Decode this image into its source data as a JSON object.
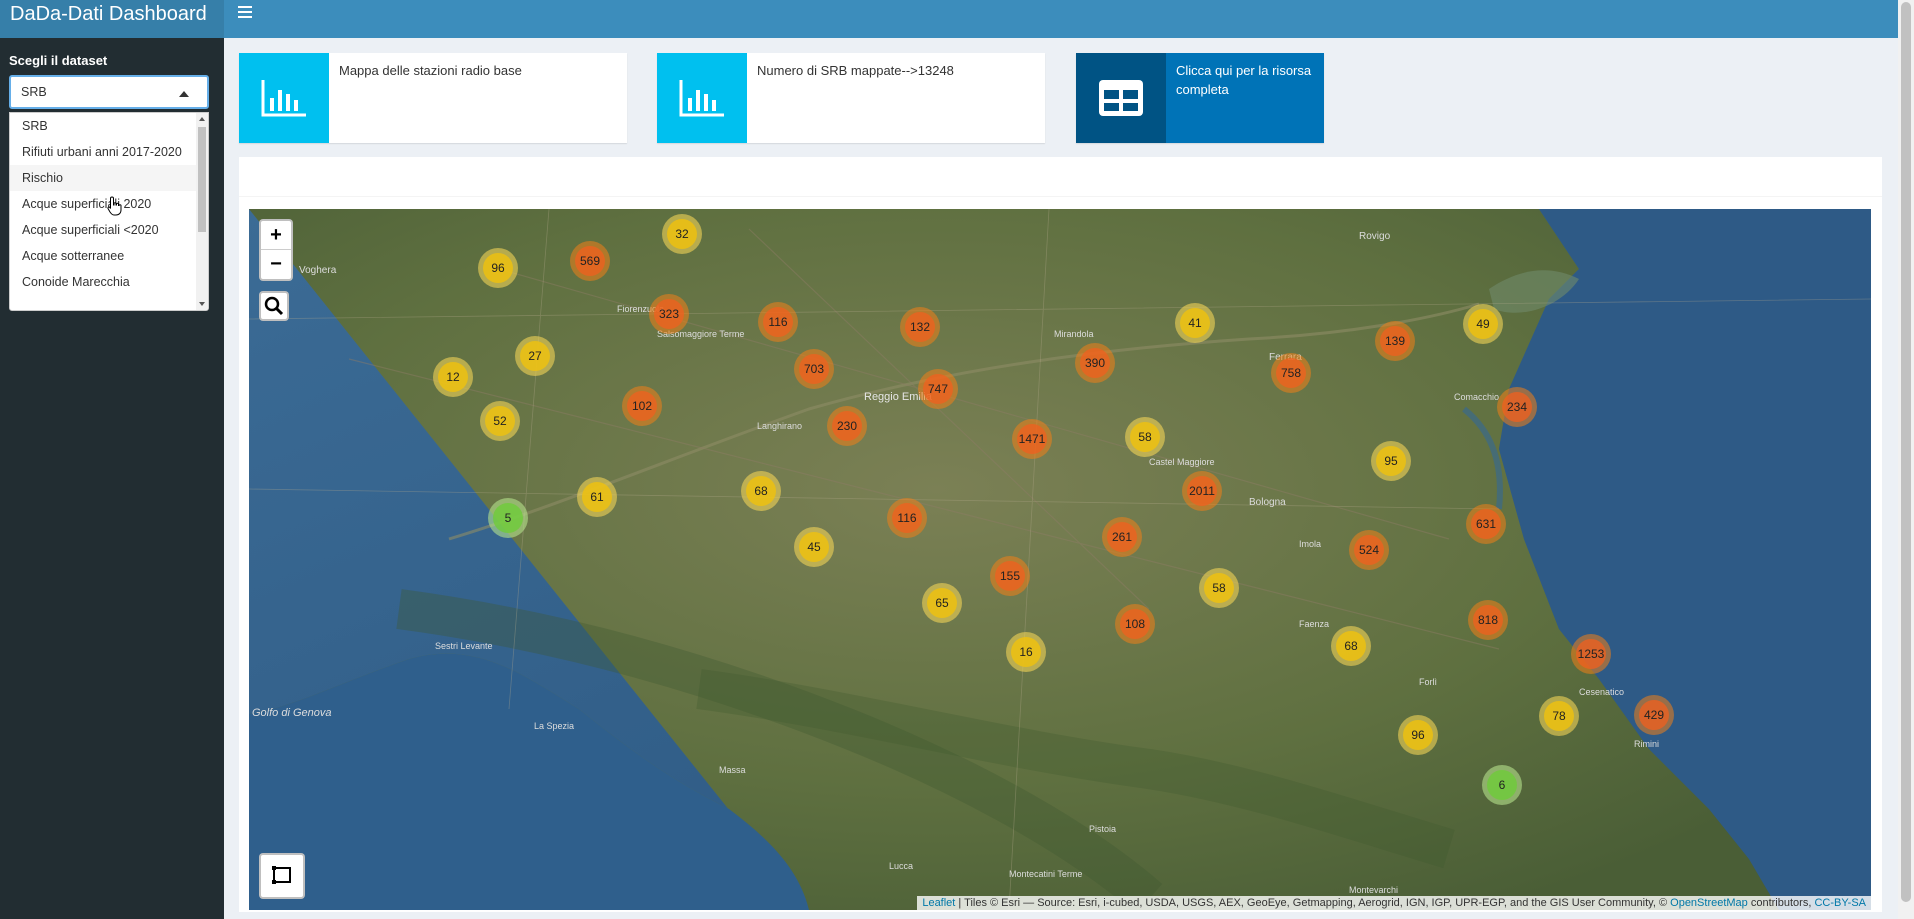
{
  "header": {
    "title": "DaDa-Dati Dashboard",
    "menu_icon": "hamburger-icon"
  },
  "sidebar": {
    "label": "Scegli il dataset",
    "select_value": "SRB",
    "options": [
      "SRB",
      "Rifiuti urbani anni 2017-2020",
      "Rischio",
      "Acque superficiali 2020",
      "Acque superficiali <2020",
      "Acque sotterranee",
      "Conoide Marecchia"
    ],
    "hovered_option": "Rischio"
  },
  "infoboxes": [
    {
      "text": "Mappa delle stazioni radio base",
      "icon": "bar-chart-icon",
      "color": "#00c0ef"
    },
    {
      "text": "Numero di SRB mappate-->13248",
      "icon": "bar-chart-icon",
      "color": "#00c0ef"
    },
    {
      "text": "Clicca qui per la risorsa completa",
      "icon": "table-icon",
      "color": "#0073b7"
    }
  ],
  "map": {
    "zoom_in": "+",
    "zoom_out": "−",
    "place_labels": [
      "Voghera",
      "Rovigo",
      "Ferrara",
      "Reggio Emilia",
      "Golfo di Genova",
      "Sestri Levante",
      "La Spezia",
      "Massa",
      "Lucca",
      "Pistoia",
      "Faenza",
      "Rimini",
      "Cesenatico",
      "Forlì",
      "Mirandola",
      "Comacchio",
      "Castel Maggiore",
      "Bologna",
      "Imola",
      "Langhirano",
      "Salsomaggiore Terme",
      "Fiorenzuola",
      "Montecatini Terme",
      "Montevarchi"
    ],
    "clusters": [
      "32",
      "96",
      "569",
      "323",
      "116",
      "132",
      "41",
      "49",
      "139",
      "27",
      "12",
      "703",
      "747",
      "390",
      "758",
      "234",
      "52",
      "102",
      "230",
      "1471",
      "58",
      "95",
      "2011",
      "61",
      "68",
      "116",
      "5",
      "631",
      "261",
      "524",
      "45",
      "155",
      "58",
      "65",
      "108",
      "818",
      "16",
      "68",
      "1253",
      "78",
      "429",
      "96",
      "6"
    ],
    "attribution": {
      "leaflet": "Leaflet",
      "tiles": " | Tiles © Esri — Source: Esri, i-cubed, USDA, USGS, AEX, GeoEye, Getmapping, Aerogrid, IGN, IGP, UPR-EGP, and the GIS User Community, © ",
      "osm": "OpenStreetMap",
      "contrib": " contributors, ",
      "license": "CC-BY-SA"
    }
  }
}
